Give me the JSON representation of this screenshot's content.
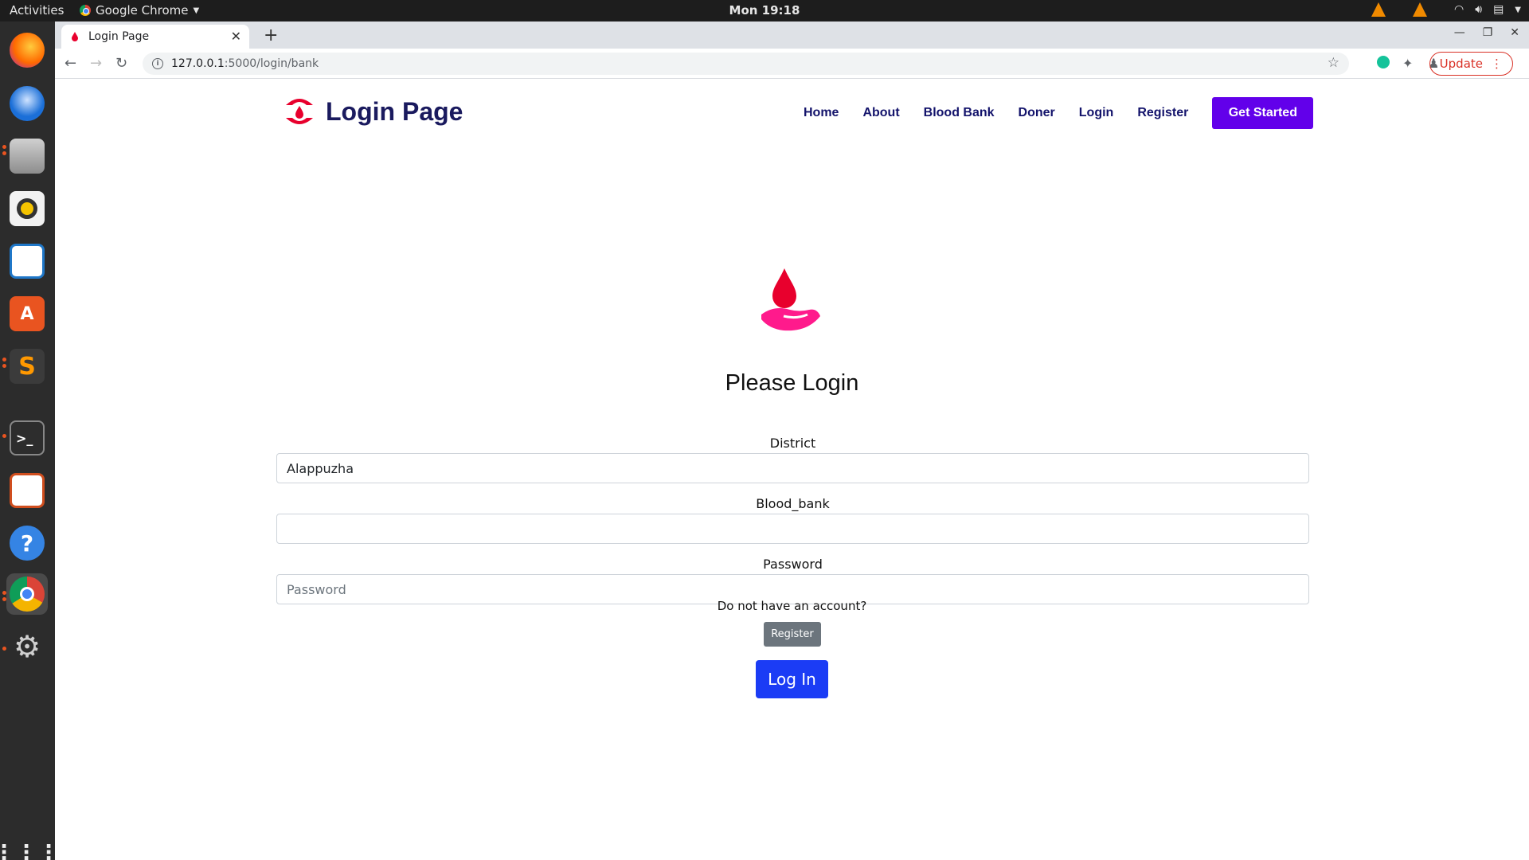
{
  "system": {
    "activities": "Activities",
    "app_name": "Google Chrome",
    "clock": "Mon 19:18"
  },
  "browser": {
    "tab_title": "Login Page",
    "url_host": "127.0.0.1",
    "url_path": ":5000/login/bank",
    "update_label": "Update"
  },
  "site": {
    "brand": "Login Page",
    "nav": [
      "Home",
      "About",
      "Blood Bank",
      "Doner",
      "Login",
      "Register"
    ],
    "cta": "Get Started"
  },
  "login": {
    "heading": "Please Login",
    "district_label": "District",
    "district_value": "Alappuzha",
    "blood_bank_label": "Blood_bank",
    "blood_bank_value": "",
    "password_label": "Password",
    "password_placeholder": "Password",
    "account_prompt": "Do not have an account?",
    "register_button": "Register",
    "login_button": "Log In"
  },
  "colors": {
    "brand_text": "#1a1a5e",
    "cta": "#6200ea",
    "login_button": "#1b3cf5",
    "register_button": "#6c757d",
    "drop": "#e8002d"
  }
}
